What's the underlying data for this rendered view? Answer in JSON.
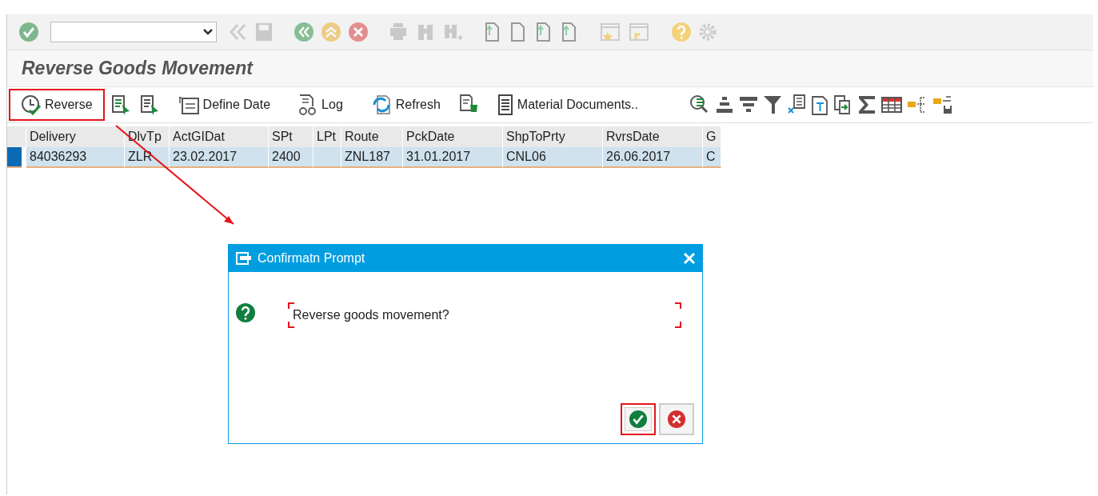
{
  "screen": {
    "title": "Reverse Goods Movement"
  },
  "toolbar": [
    {
      "kind": "reverse",
      "label": "Reverse",
      "highlighted": true
    },
    {
      "kind": "select-all"
    },
    {
      "kind": "deselect-all"
    },
    {
      "kind": "define-date",
      "label": "Define Date",
      "highlighted": false
    },
    {
      "kind": "log",
      "label": "Log",
      "highlighted": false
    },
    {
      "kind": "refresh",
      "label": "Refresh",
      "highlighted": false
    },
    {
      "kind": "doc-bin"
    },
    {
      "kind": "material",
      "label": "Material Documents..",
      "highlighted": false
    }
  ],
  "table": {
    "columns": [
      "Delivery",
      "DlvTp",
      "ActGIDat",
      "SPt",
      "LPt",
      "Route",
      "PckDate",
      "ShpToPrty",
      "RvrsDate",
      "G"
    ],
    "rows": [
      {
        "selected": true,
        "cells": [
          "84036293",
          "ZLR",
          "23.02.2017",
          "2400",
          "",
          "ZNL187",
          "31.01.2017",
          "CNL06",
          "26.06.2017",
          "C"
        ]
      }
    ]
  },
  "dialog": {
    "title": "Confirmatn Prompt",
    "message": "Reverse goods movement?",
    "ok_highlighted": true
  }
}
